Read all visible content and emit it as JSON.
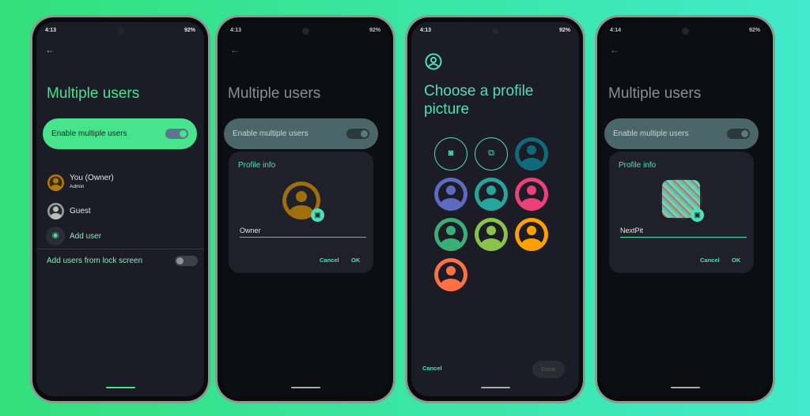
{
  "status": {
    "time1": "4:13",
    "time4": "4:14",
    "battery": "92%",
    "left_icons": "⏱ ⧓",
    "right_icons": "🔕 ▼ ▮"
  },
  "screen1": {
    "title": "Multiple users",
    "enable_label": "Enable multiple users",
    "enable_on": true,
    "users": [
      {
        "name": "You (Owner)",
        "sub": "Admin",
        "color": "#b07a10"
      },
      {
        "name": "Guest",
        "color": "#9aa3a0"
      },
      {
        "name": "Add user"
      }
    ],
    "lock_label": "Add users from lock screen",
    "lock_on": false
  },
  "screen2": {
    "title": "Multiple users",
    "enable_label": "Enable multiple users",
    "dialog_title": "Profile info",
    "name_value": "Owner",
    "cancel": "Cancel",
    "ok": "OK"
  },
  "screen3": {
    "title": "Choose a profile picture",
    "options": [
      "take-photo",
      "choose-image"
    ],
    "avatar_colors": [
      "#0f6a7a",
      "#5c6bc0",
      "#26a69a",
      "#ec407a",
      "#3aae76",
      "#8bc34a",
      "#ffa000",
      "#ff7043"
    ],
    "cancel": "Cancel",
    "done": "Done"
  },
  "screen4": {
    "title": "Multiple users",
    "enable_label": "Enable multiple users",
    "dialog_title": "Profile info",
    "name_value": "NextPit",
    "cancel": "Cancel",
    "ok": "OK"
  },
  "colors": {
    "accent1": "#47e38d",
    "accent": "#4fe0b5"
  }
}
